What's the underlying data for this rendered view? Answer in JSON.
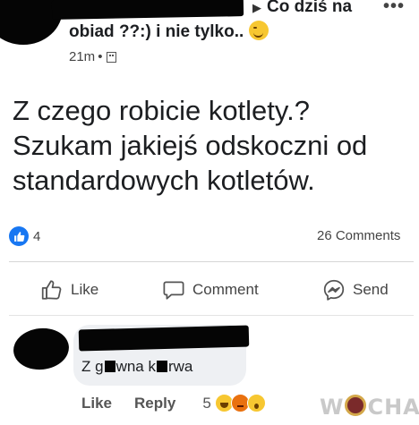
{
  "post": {
    "group_prefix": "▶",
    "group_name": "Co dziś na",
    "title_line2": "obiad ??:) i nie tylko..",
    "time": "21m",
    "meta_separator": "•",
    "body_lines": [
      "Z czego robicie kotlety.?",
      "Szukam jakiejś odskoczni od",
      "standardowych kotletów."
    ],
    "more_icon": "•••"
  },
  "stats": {
    "like_count": "4",
    "comments_label": "26 Comments"
  },
  "actions": {
    "like": "Like",
    "comment": "Comment",
    "send": "Send"
  },
  "comment": {
    "text_part1": "Z g",
    "text_part2": "wna k",
    "text_part3": "rwa",
    "like_label": "Like",
    "reply_label": "Reply",
    "reaction_count": "5",
    "reactions": [
      "haha-icon",
      "angry-icon",
      "wow-icon"
    ]
  },
  "watermark": {
    "part1": "W",
    "part2": "CHA"
  },
  "colors": {
    "like_blue": "#1877f2",
    "redaction": "#050505",
    "comment_bubble": "#eef0f3"
  }
}
